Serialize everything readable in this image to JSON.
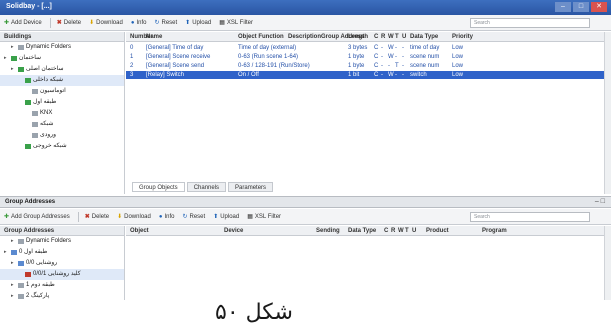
{
  "window": {
    "title": "Solidbay - [...]",
    "controls": [
      "–",
      "□",
      "✕"
    ]
  },
  "toolbar1": {
    "items": [
      {
        "icon": "plus-icon",
        "label": "Add Device"
      },
      {
        "icon": "delete-icon",
        "label": "Delete"
      },
      {
        "icon": "download-icon",
        "label": "Download"
      },
      {
        "icon": "info-icon",
        "label": "Info"
      },
      {
        "icon": "reset-icon",
        "label": "Reset"
      },
      {
        "icon": "upload-icon",
        "label": "Upload"
      },
      {
        "icon": "filter-icon",
        "label": "XSL Filter"
      }
    ],
    "search_placeholder": "Search"
  },
  "tree1": {
    "header": "Buildings",
    "items": [
      {
        "label": "Dynamic Folders",
        "indent": 1,
        "icon": "gray"
      },
      {
        "label": "ساختمان",
        "indent": 0,
        "icon": "green"
      },
      {
        "label": "ساختمان اصلی",
        "indent": 1,
        "icon": "green"
      },
      {
        "label": "شبکه داخلی",
        "indent": 2,
        "icon": "green",
        "highlight": true
      },
      {
        "label": "اتوماسیون",
        "indent": 3,
        "icon": "gray"
      },
      {
        "label": "طبقه اول",
        "indent": 2,
        "icon": "green"
      },
      {
        "label": "KNX",
        "indent": 3,
        "icon": "gray"
      },
      {
        "label": "شبکه",
        "indent": 3,
        "icon": "gray"
      },
      {
        "label": "ورودی",
        "indent": 3,
        "icon": "gray"
      },
      {
        "label": "شبکه خروجی",
        "indent": 2,
        "icon": "green"
      }
    ]
  },
  "grid1": {
    "columns": [
      "Number",
      "Name",
      "Object Function",
      "Description",
      "Group Address",
      "Length",
      "C",
      "R",
      "W",
      "T",
      "U",
      "Data Type",
      "Priority"
    ],
    "rows": [
      {
        "number": "0",
        "name": "[General] Time of day",
        "func": "Time of day (external)",
        "desc": "",
        "group": "",
        "length": "3 bytes",
        "c": "C",
        "r": "-",
        "w": "W",
        "t": "-",
        "u": "-",
        "dtype": "time of day",
        "prio": "Low",
        "selected": false
      },
      {
        "number": "1",
        "name": "[General] Scene receive",
        "func": "0-63 (Run scene 1-64)",
        "desc": "",
        "group": "",
        "length": "1 byte",
        "c": "C",
        "r": "-",
        "w": "W",
        "t": "-",
        "u": "-",
        "dtype": "scene num",
        "prio": "Low",
        "selected": false
      },
      {
        "number": "2",
        "name": "[General] Scene send",
        "func": "0-63 / 128-191 (Run/Store)",
        "desc": "",
        "group": "",
        "length": "1 byte",
        "c": "C",
        "r": "-",
        "w": "-",
        "t": "T",
        "u": "-",
        "dtype": "scene num",
        "prio": "Low",
        "selected": false
      },
      {
        "number": "3",
        "name": "[Relay] Switch",
        "func": "On / Off",
        "desc": "",
        "group": "",
        "length": "1 bit",
        "c": "C",
        "r": "-",
        "w": "W",
        "t": "-",
        "u": "-",
        "dtype": "switch",
        "prio": "Low",
        "selected": true
      }
    ]
  },
  "tabs": [
    {
      "label": "Group Objects",
      "active": true
    },
    {
      "label": "Channels",
      "active": false
    },
    {
      "label": "Parameters",
      "active": false
    }
  ],
  "section2": {
    "title": "Group Addresses",
    "controls": "– □"
  },
  "toolbar2": {
    "items": [
      {
        "icon": "plus-icon",
        "label": "Add Group Addresses"
      },
      {
        "icon": "delete-icon",
        "label": "Delete"
      },
      {
        "icon": "download-icon",
        "label": "Download"
      },
      {
        "icon": "info-icon",
        "label": "Info"
      },
      {
        "icon": "reset-icon",
        "label": "Reset"
      },
      {
        "icon": "upload-icon",
        "label": "Upload"
      },
      {
        "icon": "filter-icon",
        "label": "XSL Filter"
      }
    ],
    "search_placeholder": "Search"
  },
  "tree2": {
    "header": "Group Addresses",
    "items": [
      {
        "label": "Dynamic Folders",
        "indent": 1,
        "icon": "gray"
      },
      {
        "label": "0 طبقه اول",
        "indent": 0,
        "icon": "blue"
      },
      {
        "label": "0/0 روشنایی",
        "indent": 1,
        "icon": "blue"
      },
      {
        "label": "0/0/1 کلید روشنایی",
        "indent": 2,
        "icon": "red",
        "highlight": true
      },
      {
        "label": "1 طبقه دوم",
        "indent": 1,
        "icon": "gray"
      },
      {
        "label": "2 پارکینگ",
        "indent": 1,
        "icon": "gray"
      }
    ]
  },
  "grid2": {
    "columns": [
      "Object",
      "Device",
      "Sending",
      "Data Type",
      "C",
      "R",
      "W",
      "T",
      "U",
      "Product",
      "Program"
    ]
  },
  "caption": "شکل ۵۰"
}
